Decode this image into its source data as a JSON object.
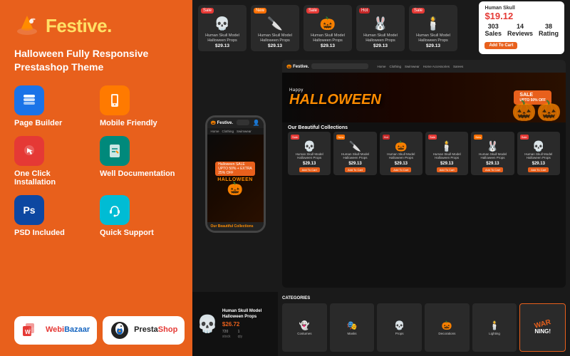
{
  "brand": {
    "name": "Festive",
    "tagline": "Halloween Fully Responsive\nPrestashop Theme"
  },
  "features": [
    {
      "id": "page-builder",
      "label": "Page Builder",
      "icon": "🗂️",
      "color_class": "icon-blue"
    },
    {
      "id": "mobile-friendly",
      "label": "Mobile Friendly",
      "icon": "📱",
      "color_class": "icon-orange2"
    },
    {
      "id": "one-click",
      "label": "One Click Installation",
      "icon": "👆",
      "color_class": "icon-red"
    },
    {
      "id": "documentation",
      "label": "Well Documentation",
      "icon": "📄",
      "color_class": "icon-teal"
    },
    {
      "id": "psd",
      "label": "PSD Included",
      "icon": "🖼️",
      "color_class": "icon-blue2"
    },
    {
      "id": "support",
      "label": "Quick Support",
      "icon": "🎧",
      "color_class": "icon-cyan"
    }
  ],
  "bottom_logos": [
    {
      "id": "webibazaar",
      "text": "WebiBazaar",
      "icon": "🏪",
      "color": "red"
    },
    {
      "id": "prestashop",
      "text": "PrestaShop",
      "icon": "🦜",
      "color": "blue"
    }
  ],
  "top_products": [
    {
      "title": "Human Skull Model Halloween Props",
      "price": "$29.13",
      "badge": "Sale",
      "icon": "💀"
    },
    {
      "title": "Human Skull Model Halloween Props",
      "price": "$29.13",
      "badge": "New",
      "icon": "🔪"
    },
    {
      "title": "Human Skull Model Halloween Props",
      "price": "$29.13",
      "badge": "Sale",
      "icon": "🎃"
    },
    {
      "title": "Human Skull Model Halloween Props",
      "price": "$29.13",
      "badge": "Hot",
      "icon": "🐰"
    },
    {
      "title": "Human Skull Model Halloween Props",
      "price": "$29.13",
      "badge": "Sale",
      "icon": "🕯️"
    }
  ],
  "price_box": {
    "title": "Human Skull",
    "price": "$19.12",
    "stats": [
      {
        "label": "Sales",
        "value": "303"
      },
      {
        "label": "Reviews",
        "value": "14"
      },
      {
        "label": "Rating",
        "value": "38"
      }
    ],
    "btn_label": "Add To Cart"
  },
  "hero": {
    "label": "Happy",
    "big_text": "HALLOWEEN",
    "sale_text": "SALE",
    "sale_detail": "UPTO 50% OFF"
  },
  "collections_title": "Our Beautiful Collections",
  "desktop_products": [
    {
      "badge": "Sale",
      "title": "Human Skull Model Halloween Props",
      "price": "$29.13",
      "icon": "💀"
    },
    {
      "badge": "New",
      "title": "Human Skull Model Halloween Props",
      "price": "$29.13",
      "icon": "🔪"
    },
    {
      "badge": "Hot",
      "title": "Human Skull Model Halloween Props",
      "price": "$29.13",
      "icon": "🎃"
    },
    {
      "badge": "Sale",
      "title": "Human Skull Model Halloween Props",
      "price": "$29.13",
      "icon": "🕯️"
    },
    {
      "badge": "New",
      "title": "Human Skull Model Halloween Props",
      "price": "$29.13",
      "icon": "🐰"
    },
    {
      "badge": "Sale",
      "title": "Human Skull Model Halloween Props",
      "price": "$29.13",
      "icon": "💀"
    }
  ],
  "mobile_nav": [
    "Home",
    "Clothing",
    "Swimwear",
    "Home Accessories",
    "Sarees"
  ],
  "featured_product": {
    "title": "Human Skull Model Halloween Props",
    "price": "$26.72",
    "icon": "💀"
  },
  "categories_title": "CATEGORIES",
  "categories": [
    {
      "label": "Costumes",
      "icon": "👻"
    },
    {
      "label": "Masks",
      "icon": "🎭"
    },
    {
      "label": "Props",
      "icon": "💀"
    },
    {
      "label": "Decorations",
      "icon": "🎃"
    },
    {
      "label": "Lighting",
      "icon": "🕯️"
    }
  ]
}
